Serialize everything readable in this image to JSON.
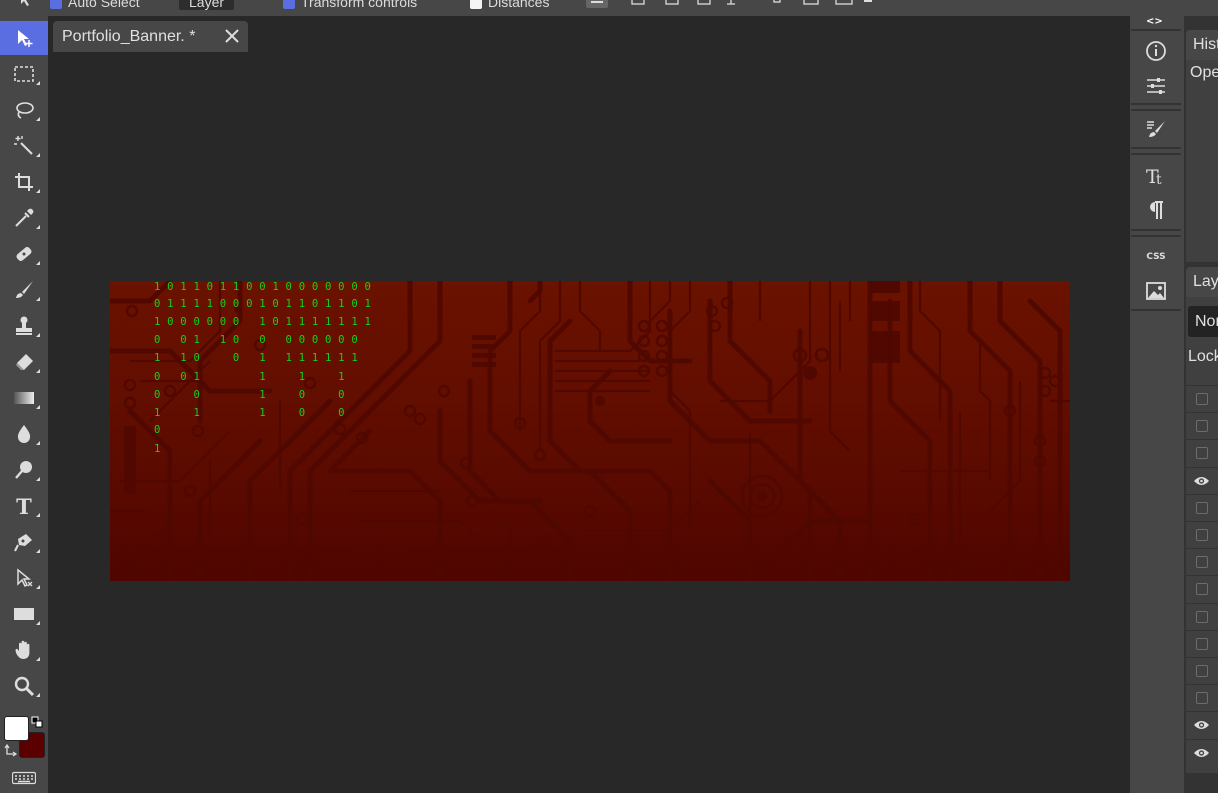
{
  "topbar": {
    "auto_select_label": "Auto Select",
    "layer_select_value": "Layer",
    "transform_controls_label": "Transform controls",
    "distances_label": "Distances"
  },
  "toolbar": {
    "tools": [
      "move-tool",
      "marquee-tool",
      "lasso-tool",
      "magic-wand-tool",
      "crop-tool",
      "eyedropper-tool",
      "healing-brush-tool",
      "brush-tool",
      "clone-stamp-tool",
      "eraser-tool",
      "gradient-tool",
      "blur-tool",
      "dodge-tool",
      "type-tool",
      "pen-tool",
      "path-select-tool",
      "rectangle-tool",
      "hand-tool",
      "zoom-tool"
    ],
    "foreground_color": "#ffffff",
    "background_color": "#5a0000"
  },
  "document": {
    "tab_name": "Portfolio_Banner.",
    "tab_faded": "",
    "modified_marker": "*"
  },
  "canvas": {
    "binary_rows": [
      "1 0 1 1 0 1 1 0 0 1 0 0 0 0 0 0 0",
      "0 1 1 1 1 0 0 0 1 0 1 1 0 1 1 0 1",
      "1 0 0 0 0 0 0   1 0 1 1 1 1 1 1 1",
      "0   0 1   1 0   0   0 0 0 0 0 0",
      "1   1 0     0   1   1 1 1 1 1 1",
      "0   0 1         1     1     1",
      "0     0         1     0     0",
      "1     1         1     0     0",
      "0",
      "1"
    ]
  },
  "right_strip": {
    "collapse_label": "<>",
    "icons": [
      "info-icon",
      "adjustments-icon",
      "brush-settings-icon",
      "character-icon",
      "paragraph-icon",
      "css-icon",
      "image-icon"
    ],
    "css_label": "CSS"
  },
  "panels": {
    "history_title": "History",
    "history_first_item": "Open",
    "layers_title": "Layers",
    "blend_mode": "Normal",
    "lock_label": "Lock:",
    "layer_visibility": [
      false,
      false,
      false,
      true,
      false,
      false,
      false,
      false,
      false,
      false,
      false,
      false,
      true,
      true
    ]
  }
}
